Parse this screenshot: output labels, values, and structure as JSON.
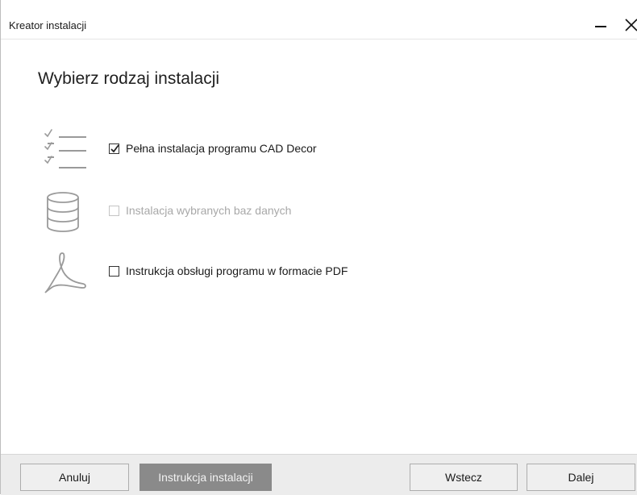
{
  "window": {
    "title": "Kreator instalacji"
  },
  "main": {
    "heading": "Wybierz rodzaj instalacji",
    "options": [
      {
        "label": "Pełna instalacja programu CAD Decor",
        "checked": true,
        "enabled": true,
        "icon": "checklist-icon"
      },
      {
        "label": "Instalacja wybranych baz danych",
        "checked": false,
        "enabled": false,
        "icon": "database-icon"
      },
      {
        "label": "Instrukcja obsługi programu w formacie PDF",
        "checked": false,
        "enabled": true,
        "icon": "pdf-icon"
      }
    ]
  },
  "footer": {
    "cancel_label": "Anuluj",
    "manual_label": "Instrukcja instalacji",
    "back_label": "Wstecz",
    "next_label": "Dalej"
  }
}
